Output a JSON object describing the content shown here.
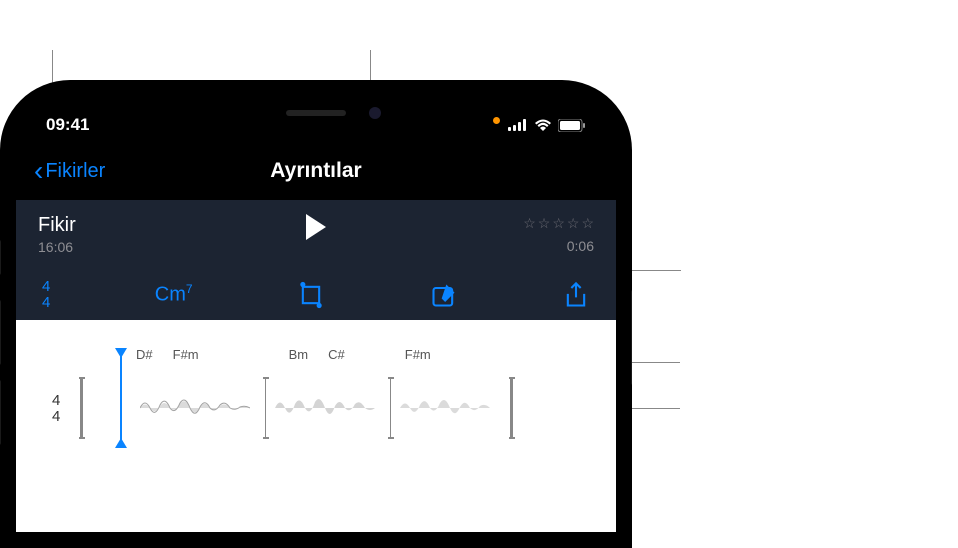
{
  "status": {
    "time": "09:41"
  },
  "nav": {
    "back_label": "Fikirler",
    "title": "Ayrıntılar"
  },
  "idea": {
    "title": "Fikir",
    "timestamp": "16:06",
    "duration": "0:06",
    "rating": 0
  },
  "info": {
    "time_sig_num": "4",
    "time_sig_den": "4",
    "chord": "Cm",
    "chord_ext": "7"
  },
  "waveform": {
    "time_sig_num": "4",
    "time_sig_den": "4",
    "chords": [
      "D#",
      "F#m",
      "Bm",
      "C#",
      "F#m"
    ]
  },
  "icons": {
    "trim": "trim-icon",
    "edit": "edit-icon",
    "share": "share-icon",
    "play": "play-icon"
  }
}
